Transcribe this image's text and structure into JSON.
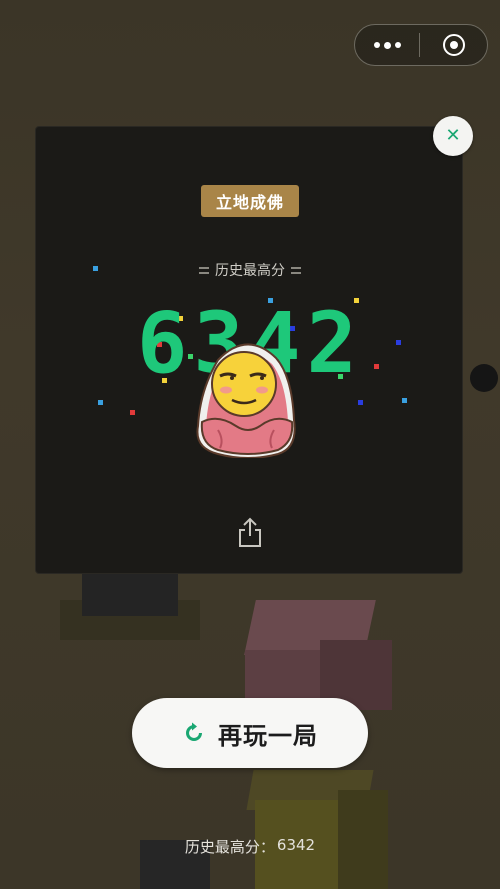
{
  "top_capsule": {
    "more_icon": "more-dots-icon",
    "close_mini_icon": "target-circle-icon"
  },
  "panel": {
    "rank_badge": "立地成佛",
    "best_title": "历史最高分",
    "big_score": "6342",
    "close_icon": "close-x-icon",
    "share_icon": "share-icon"
  },
  "replay": {
    "label": "再玩一局",
    "icon": "replay-icon"
  },
  "footer": {
    "label": "历史最高分：",
    "value": "6342"
  },
  "colors": {
    "accent_green": "#1aa772",
    "badge_gold": "#a98548",
    "score_green": "#1ec87a",
    "panel_bg": "#1b1a17"
  }
}
